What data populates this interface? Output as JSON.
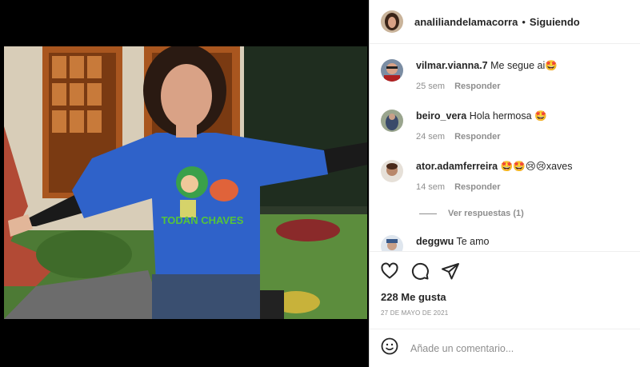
{
  "post": {
    "author": "analiliandelamacorra",
    "separator": "•",
    "follow_status": "Siguiendo",
    "likes": "228 Me gusta",
    "date": "27 DE MAYO DE 2021"
  },
  "shirt_text": "TODAN CHAVES",
  "comments": [
    {
      "username": "vilmar.vianna.7",
      "text": "Me segue ai🤩",
      "time": "25 sem",
      "reply_label": "Responder"
    },
    {
      "username": "beiro_vera",
      "text": "Hola hermosa 🤩",
      "time": "24 sem",
      "reply_label": "Responder"
    },
    {
      "username": "ator.adamferreira",
      "text": "🤩🤩😢😢xaves",
      "time": "14 sem",
      "reply_label": "Responder"
    },
    {
      "username": "deggwu",
      "text": "Te amo",
      "time": "",
      "reply_label": ""
    }
  ],
  "view_replies": "Ver respuestas (1)",
  "add_comment": {
    "placeholder": "Añade un comentario..."
  },
  "icons": [
    "heart-icon",
    "comment-icon",
    "share-icon",
    "emoji-icon"
  ],
  "colors": {
    "shirt_blue": "#2f62c9",
    "meta_gray": "#8e8e8e",
    "text_dark": "#262626"
  }
}
